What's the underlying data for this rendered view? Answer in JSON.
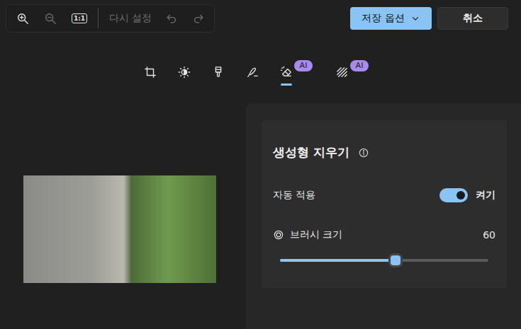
{
  "toolbar": {
    "zoom_in": {
      "disabled": false
    },
    "zoom_out": {
      "disabled": true
    },
    "actual_size": {
      "label": "1:1",
      "disabled": false
    },
    "reset": {
      "label": "다시 설정",
      "disabled": true
    },
    "undo": {
      "disabled": true
    },
    "redo": {
      "disabled": true
    }
  },
  "save_button": {
    "label": "저장 옵션"
  },
  "cancel_button": {
    "label": "취소"
  },
  "tools": [
    {
      "kind": "crop",
      "selected": false
    },
    {
      "kind": "adjust",
      "selected": false
    },
    {
      "kind": "filter",
      "selected": false
    },
    {
      "kind": "markup",
      "selected": false
    },
    {
      "kind": "erase",
      "selected": true,
      "badge": "AI"
    },
    {
      "kind": "background",
      "selected": false,
      "badge": "AI"
    }
  ],
  "panel": {
    "title": "생성형 지우기",
    "auto_apply": {
      "label": "자동 적용",
      "on": true,
      "state_label": "켜기"
    },
    "brush": {
      "label": "브러시 크기",
      "value": "60",
      "level": 0.554
    }
  }
}
